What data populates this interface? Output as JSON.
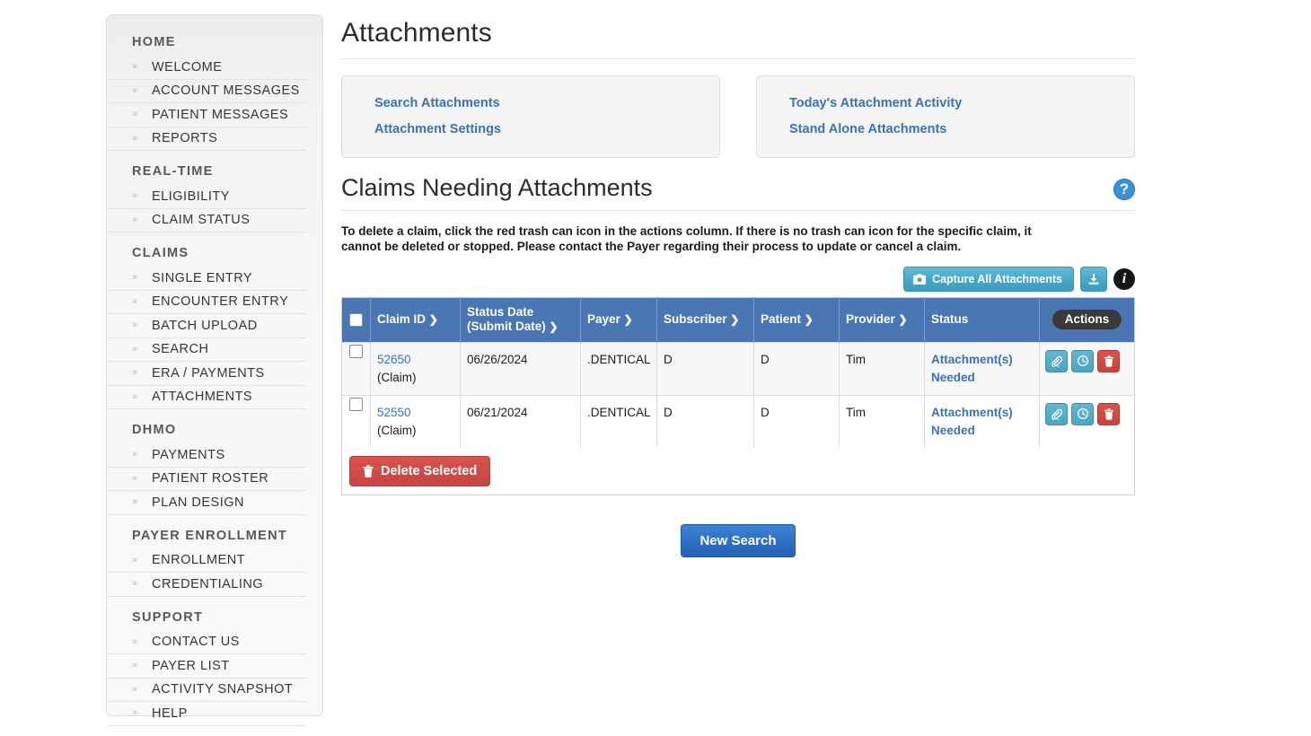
{
  "sidebar": {
    "groups": [
      {
        "heading": "HOME",
        "items": [
          {
            "label": "WELCOME"
          },
          {
            "label": "ACCOUNT MESSAGES"
          },
          {
            "label": "PATIENT MESSAGES"
          },
          {
            "label": "REPORTS"
          }
        ]
      },
      {
        "heading": "REAL-TIME",
        "items": [
          {
            "label": "ELIGIBILITY"
          },
          {
            "label": "CLAIM STATUS"
          }
        ]
      },
      {
        "heading": "CLAIMS",
        "items": [
          {
            "label": "SINGLE ENTRY"
          },
          {
            "label": "ENCOUNTER ENTRY"
          },
          {
            "label": "BATCH UPLOAD"
          },
          {
            "label": "SEARCH"
          },
          {
            "label": "ERA / PAYMENTS"
          },
          {
            "label": "ATTACHMENTS"
          }
        ]
      },
      {
        "heading": "DHMO",
        "items": [
          {
            "label": "PAYMENTS"
          },
          {
            "label": "PATIENT ROSTER"
          },
          {
            "label": "PLAN DESIGN"
          }
        ]
      },
      {
        "heading": "PAYER ENROLLMENT",
        "items": [
          {
            "label": "ENROLLMENT"
          },
          {
            "label": "CREDENTIALING"
          }
        ]
      },
      {
        "heading": "SUPPORT",
        "items": [
          {
            "label": "CONTACT US"
          },
          {
            "label": "PAYER LIST"
          },
          {
            "label": "ACTIVITY SNAPSHOT"
          },
          {
            "label": "HELP"
          }
        ]
      }
    ],
    "chevron_glyph": "»"
  },
  "main": {
    "page_title": "Attachments",
    "panel_left": {
      "links": [
        {
          "label": "Search Attachments"
        },
        {
          "label": "Attachment Settings"
        }
      ]
    },
    "panel_right": {
      "links": [
        {
          "label": "Today's Attachment Activity"
        },
        {
          "label": "Stand Alone Attachments"
        }
      ]
    },
    "section_title": "Claims Needing Attachments",
    "help_glyph": "?",
    "info_glyph": "i",
    "instructions": "To delete a claim, click the red trash can icon in the actions column. If there is no trash can icon for the specific claim, it cannot be deleted or stopped. Please contact the Payer regarding their process to update or cancel a claim.",
    "toolbar": {
      "capture_label": "Capture All Attachments",
      "camera_icon": "camera-icon",
      "download_icon": "download-icon",
      "info_icon": "info-icon"
    },
    "table": {
      "columns": [
        {
          "label": "",
          "sortable": false
        },
        {
          "label": "Claim ID",
          "sortable": true
        },
        {
          "label": "Status Date",
          "label2": "(Submit Date)",
          "sortable": true
        },
        {
          "label": "Payer",
          "sortable": true
        },
        {
          "label": "Subscriber",
          "sortable": true
        },
        {
          "label": "Patient",
          "sortable": true
        },
        {
          "label": "Provider",
          "sortable": true
        },
        {
          "label": "Status",
          "sortable": false
        },
        {
          "label": "Actions",
          "sortable": false
        }
      ],
      "sort_caret": "❯",
      "rows": [
        {
          "claim_id": "52650",
          "claim_type": "(Claim)",
          "status_date": "06/26/2024",
          "payer": ".DENTICAL",
          "subscriber": "D",
          "patient": "D",
          "provider": "Tim",
          "status": "Attachment(s) Needed",
          "actions": [
            "paperclip-icon",
            "clock-icon",
            "trash-icon"
          ]
        },
        {
          "claim_id": "52550",
          "claim_type": "(Claim)",
          "status_date": "06/21/2024",
          "payer": ".DENTICAL",
          "subscriber": "D",
          "patient": "D",
          "provider": "Tim",
          "status": "Attachment(s) Needed",
          "actions": [
            "paperclip-icon",
            "clock-icon",
            "trash-icon"
          ]
        }
      ],
      "delete_selected_label": "Delete Selected"
    },
    "new_search_label": "New Search"
  },
  "colors": {
    "table_header_blue": "#4a76b4",
    "link_blue": "#3b72b5",
    "primary_button_blue": "#2f6fc4",
    "danger_red": "#c9423d",
    "teal_button": "#49a5c2",
    "actions_pill_dark": "#3a3a3a",
    "help_icon_blue": "#3b8fd4",
    "row_alt_bg": "#f7f7f7",
    "panel_bg": "#f4f4f4",
    "sidebar_bg": "#f7f7f7"
  }
}
